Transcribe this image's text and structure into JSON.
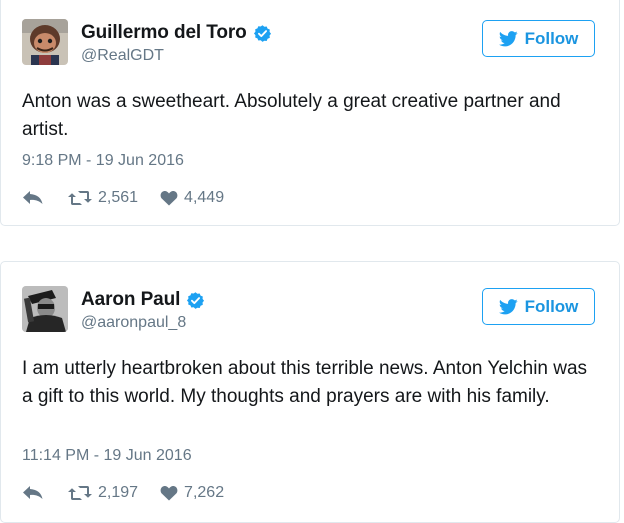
{
  "tweets": [
    {
      "display_name": "Guillermo del Toro",
      "handle": "@RealGDT",
      "follow_label": "Follow",
      "text": "Anton was a sweetheart. Absolutely a great creative partner and artist.",
      "timestamp": "9:18 PM - 19 Jun 2016",
      "retweets": "2,561",
      "likes": "4,449",
      "verified": true
    },
    {
      "display_name": "Aaron Paul",
      "handle": "@aaronpaul_8",
      "follow_label": "Follow",
      "text": "I am utterly heartbroken about this terrible news. Anton Yelchin was a gift to this world. My thoughts and prayers are with his family.",
      "timestamp": "11:14 PM - 19 Jun 2016",
      "retweets": "2,197",
      "likes": "7,262",
      "verified": true
    }
  ],
  "icons": {
    "verified": "verified-badge-icon",
    "follow": "twitter-bird-icon",
    "reply": "reply-icon",
    "retweet": "retweet-icon",
    "like": "heart-icon"
  },
  "colors": {
    "accent": "#1da1f2",
    "follow_text": "#1b95e0",
    "muted": "#657786",
    "text": "#14171a",
    "border": "#e1e8ed"
  }
}
